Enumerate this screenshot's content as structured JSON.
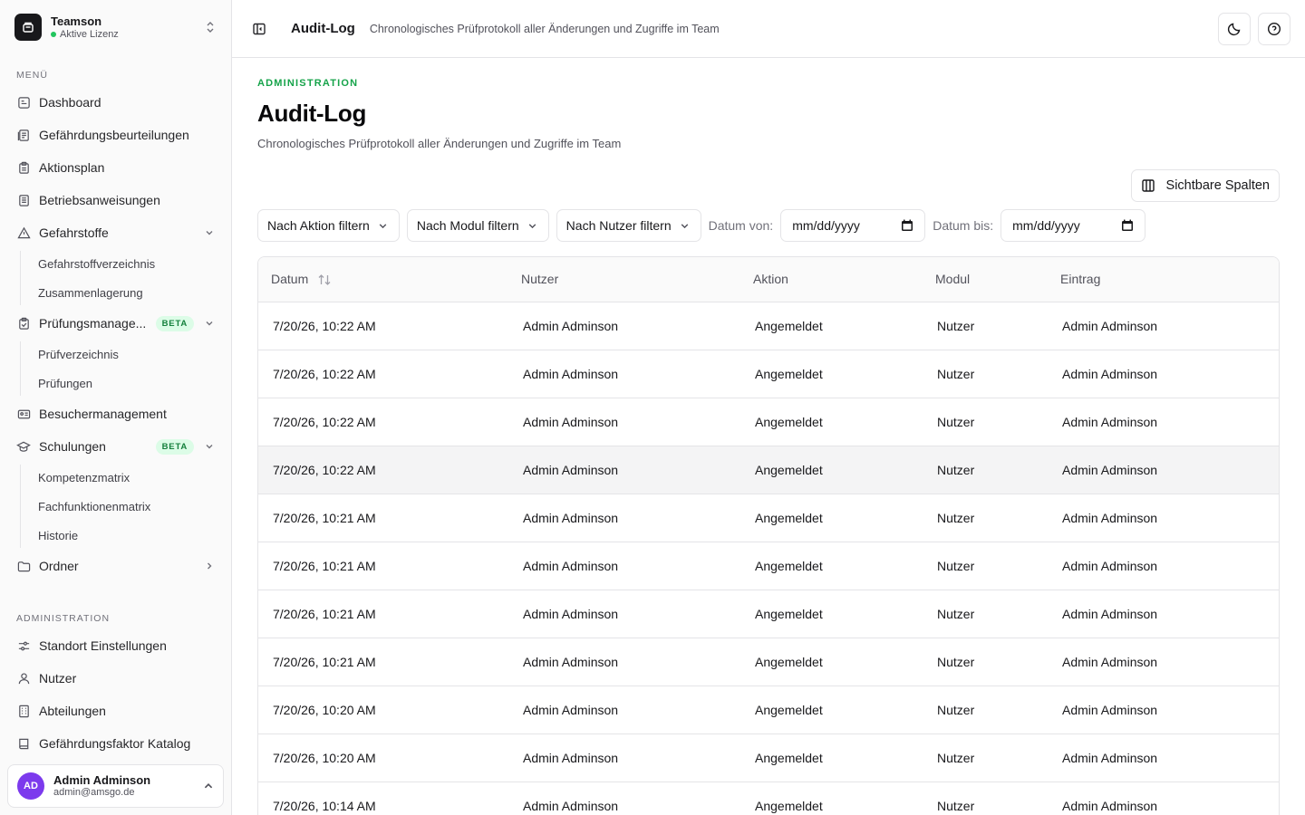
{
  "sidebar": {
    "team": {
      "name": "Teamson",
      "status": "Aktive Lizenz"
    },
    "menu_label": "MENÜ",
    "items": [
      {
        "label": "Dashboard",
        "icon": "dashboard-icon"
      },
      {
        "label": "Gefährdungsbeurteilungen",
        "icon": "document-list-icon"
      },
      {
        "label": "Aktionsplan",
        "icon": "clipboard-icon"
      },
      {
        "label": "Betriebsanweisungen",
        "icon": "book-icon"
      },
      {
        "label": "Gefahrstoffe",
        "icon": "warning-icon",
        "expanded": true,
        "children": [
          "Gefahrstoffverzeichnis",
          "Zusammenlagerung"
        ]
      },
      {
        "label": "Prüfungsmanage...",
        "icon": "clipboard-check-icon",
        "badge": "BETA",
        "expanded": true,
        "children": [
          "Prüfverzeichnis",
          "Prüfungen"
        ]
      },
      {
        "label": "Besuchermanagement",
        "icon": "id-card-icon"
      },
      {
        "label": "Schulungen",
        "icon": "graduation-cap-icon",
        "badge": "BETA",
        "expanded": true,
        "children": [
          "Kompetenzmatrix",
          "Fachfunktionenmatrix",
          "Historie"
        ]
      },
      {
        "label": "Ordner",
        "icon": "folder-icon",
        "collapsed": true
      }
    ],
    "admin_label": "ADMINISTRATION",
    "admin_items": [
      {
        "label": "Standort Einstellungen",
        "icon": "sliders-icon"
      },
      {
        "label": "Nutzer",
        "icon": "user-icon"
      },
      {
        "label": "Abteilungen",
        "icon": "building-icon"
      },
      {
        "label": "Gefährdungsfaktor Katalog",
        "icon": "catalog-icon"
      }
    ],
    "user": {
      "initials": "AD",
      "name": "Admin Adminson",
      "email": "admin@amsgo.de"
    }
  },
  "topbar": {
    "title": "Audit-Log",
    "subtitle": "Chronologisches Prüfprotokoll aller Änderungen und Zugriffe im Team"
  },
  "page": {
    "eyebrow": "ADMINISTRATION",
    "title": "Audit-Log",
    "subtitle": "Chronologisches Prüfprotokoll aller Änderungen und Zugriffe im Team",
    "columns_button": "Sichtbare Spalten"
  },
  "filters": {
    "action": "Nach Aktion filtern",
    "module": "Nach Modul filtern",
    "user": "Nach Nutzer filtern",
    "date_from_label": "Datum von:",
    "date_from_placeholder": "mm/dd/yyyy",
    "date_to_label": "Datum bis:",
    "date_to_placeholder": "mm/dd/yyyy"
  },
  "table": {
    "headers": [
      "Datum",
      "Nutzer",
      "Aktion",
      "Modul",
      "Eintrag"
    ],
    "highlighted_row": 3,
    "rows": [
      [
        "7/20/26, 10:22 AM",
        "Admin Adminson",
        "Angemeldet",
        "Nutzer",
        "Admin Adminson"
      ],
      [
        "7/20/26, 10:22 AM",
        "Admin Adminson",
        "Angemeldet",
        "Nutzer",
        "Admin Adminson"
      ],
      [
        "7/20/26, 10:22 AM",
        "Admin Adminson",
        "Angemeldet",
        "Nutzer",
        "Admin Adminson"
      ],
      [
        "7/20/26, 10:22 AM",
        "Admin Adminson",
        "Angemeldet",
        "Nutzer",
        "Admin Adminson"
      ],
      [
        "7/20/26, 10:21 AM",
        "Admin Adminson",
        "Angemeldet",
        "Nutzer",
        "Admin Adminson"
      ],
      [
        "7/20/26, 10:21 AM",
        "Admin Adminson",
        "Angemeldet",
        "Nutzer",
        "Admin Adminson"
      ],
      [
        "7/20/26, 10:21 AM",
        "Admin Adminson",
        "Angemeldet",
        "Nutzer",
        "Admin Adminson"
      ],
      [
        "7/20/26, 10:21 AM",
        "Admin Adminson",
        "Angemeldet",
        "Nutzer",
        "Admin Adminson"
      ],
      [
        "7/20/26, 10:20 AM",
        "Admin Adminson",
        "Angemeldet",
        "Nutzer",
        "Admin Adminson"
      ],
      [
        "7/20/26, 10:20 AM",
        "Admin Adminson",
        "Angemeldet",
        "Nutzer",
        "Admin Adminson"
      ],
      [
        "7/20/26, 10:14 AM",
        "Admin Adminson",
        "Angemeldet",
        "Nutzer",
        "Admin Adminson"
      ]
    ]
  },
  "colors": {
    "accent": "#16a34a",
    "avatar": "#7c3aed",
    "beta_bg": "#dcfce7",
    "beta_text": "#15803d"
  }
}
